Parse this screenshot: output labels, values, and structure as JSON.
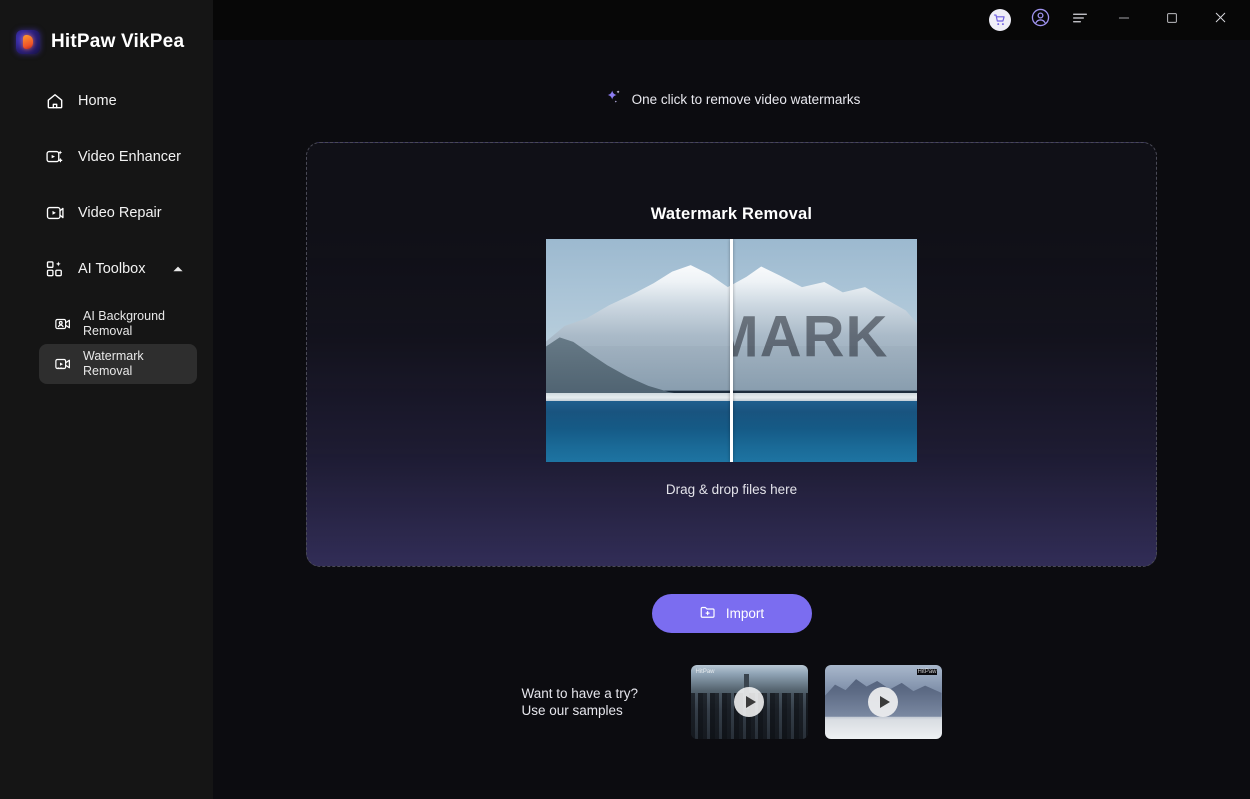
{
  "app": {
    "brand": "HitPaw VikPea",
    "logo_icon": "hitpaw-logo-icon"
  },
  "titlebar": {
    "buttons": [
      {
        "name": "cart-icon",
        "label": "Cart"
      },
      {
        "name": "account-icon",
        "label": "Account"
      },
      {
        "name": "menu-icon",
        "label": "Menu"
      },
      {
        "name": "minimize-icon",
        "label": "Minimize"
      },
      {
        "name": "maximize-icon",
        "label": "Maximize"
      },
      {
        "name": "close-icon",
        "label": "Close"
      }
    ]
  },
  "sidebar": {
    "items": [
      {
        "label": "Home",
        "icon": "home-icon"
      },
      {
        "label": "Video Enhancer",
        "icon": "video-enhancer-icon"
      },
      {
        "label": "Video Repair",
        "icon": "video-repair-icon"
      },
      {
        "label": "AI Toolbox",
        "icon": "ai-toolbox-icon",
        "expanded": true,
        "caret": "chevron-up-icon"
      }
    ],
    "subitems": [
      {
        "label": "AI Background\nRemoval",
        "icon": "ai-background-removal-icon",
        "active": false
      },
      {
        "label": "Watermark\nRemoval",
        "icon": "watermark-removal-icon",
        "active": true
      }
    ]
  },
  "main": {
    "tagline": "One click to remove video watermarks",
    "tagline_icon": "sparkle-icon",
    "dropzone": {
      "title": "Watermark Removal",
      "hint": "Drag & drop files here",
      "preview_watermark_text": "RMARK",
      "preview_name": "watermark-before-after-preview"
    },
    "import_button": {
      "label": "Import",
      "icon": "folder-plus-icon",
      "color": "#7b6df0"
    },
    "samples": {
      "text": "Want to have a try?\nUse our samples",
      "items": [
        {
          "name": "sample-video-city",
          "overlay_label": "HitPaw"
        },
        {
          "name": "sample-video-mountain",
          "overlay_label": "HitPaw"
        }
      ]
    }
  },
  "colors": {
    "accent": "#7b6df0",
    "sidebar_bg": "#151515",
    "titlebar_bg": "#070707",
    "main_bg": "#0c0c10",
    "active_item_bg": "#2e2e2e"
  }
}
